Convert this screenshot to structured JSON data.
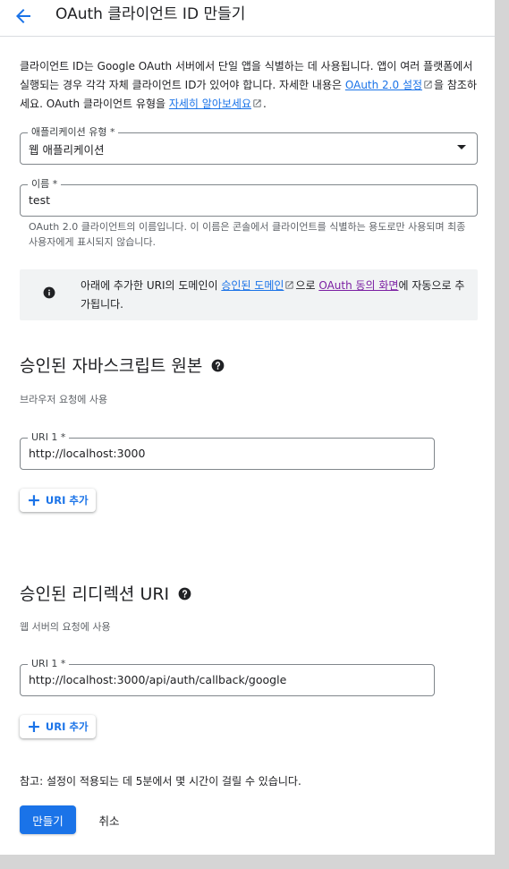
{
  "header": {
    "title": "OAuth 클라이언트 ID 만들기"
  },
  "intro": {
    "text1": "클라이언트 ID는 Google OAuth 서버에서 단일 앱을 식별하는 데 사용됩니다. 앱이 여러 플랫폼에서 실행되는 경우 각각 자체 클라이언트 ID가 있어야 합니다. 자세한 내용은 ",
    "link_settings": "OAuth 2.0 설정",
    "text2": "을 참조하세요. OAuth 클라이언트 유형을 ",
    "link_learn_more": "자세히 알아보세요",
    "text3": "."
  },
  "app_type": {
    "label": "애플리케이션 유형 *",
    "value": "웹 애플리케이션"
  },
  "name_field": {
    "label": "이름 *",
    "value": "test",
    "hint": "OAuth 2.0 클라이언트의 이름입니다. 이 이름은 콘솔에서 클라이언트를 식별하는 용도로만 사용되며 최종 사용자에게 표시되지 않습니다."
  },
  "info": {
    "text1": "아래에 추가한 URI의 도메인이 ",
    "link_domain": "승인된 도메인",
    "text2": "으로 ",
    "link_consent": "OAuth 동의 화면",
    "text3": "에 자동으로 추가됩니다."
  },
  "js_origins": {
    "title": "승인된 자바스크립트 원본",
    "subtitle": "브라우저 요청에 사용",
    "uri_label": "URI 1 *",
    "uri_value": "http://localhost:3000",
    "add_label": "URI 추가"
  },
  "redirect_uris": {
    "title": "승인된 리디렉션 URI",
    "subtitle": "웹 서버의 요청에 사용",
    "uri_label": "URI 1 *",
    "uri_value": "http://localhost:3000/api/auth/callback/google",
    "add_label": "URI 추가"
  },
  "note": "참고: 설정이 적용되는 데 5분에서 몇 시간이 걸릴 수 있습니다.",
  "actions": {
    "create": "만들기",
    "cancel": "취소"
  },
  "colors": {
    "primary": "#1a73e8",
    "visited_link": "#7b1fa2",
    "info_bg": "#f1f3f4",
    "page_bg": "#d5d5d5"
  },
  "icons": [
    "back-arrow-icon",
    "external-link-icon",
    "dropdown-arrow-icon",
    "info-icon",
    "help-icon",
    "plus-icon"
  ]
}
